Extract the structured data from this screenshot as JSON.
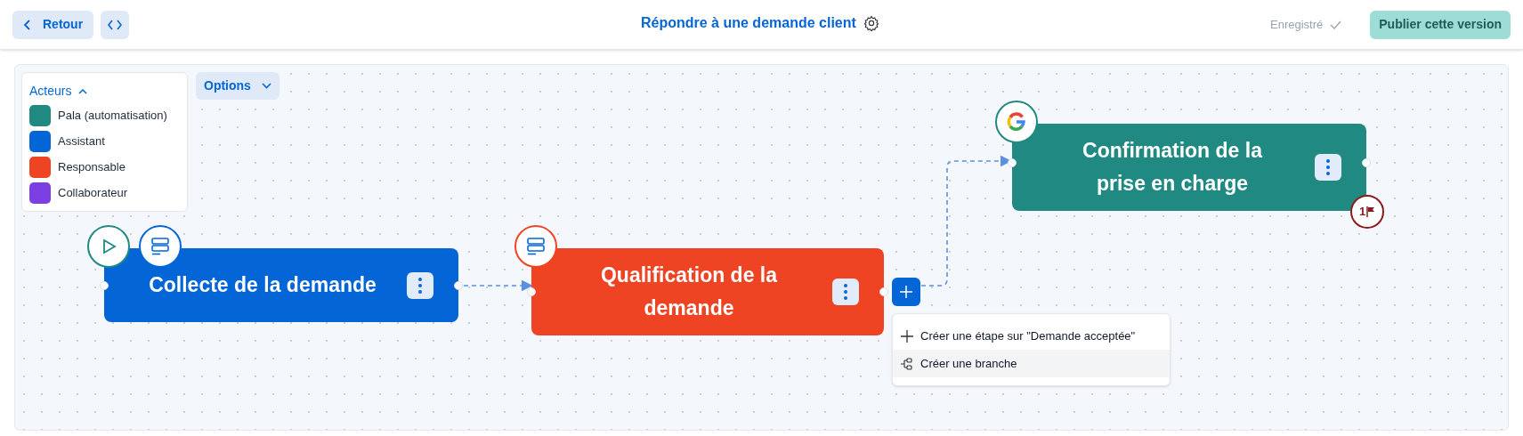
{
  "header": {
    "back_button": "Retour",
    "title": "Répondre à une demande client",
    "save_status": "Enregistré",
    "publish_button": "Publier cette version"
  },
  "legend": {
    "title": "Acteurs",
    "expanded": true,
    "items": [
      {
        "label": "Pala (automatisation)",
        "color": "#208a82"
      },
      {
        "label": "Assistant",
        "color": "#0466d6"
      },
      {
        "label": "Responsable",
        "color": "#ef4423"
      },
      {
        "label": "Collaborateur",
        "color": "#7b3fe4"
      }
    ]
  },
  "options_button": "Options",
  "nodes": [
    {
      "title": "Collecte de la demande",
      "color": "#0466d6",
      "badges": [
        {
          "kind": "start",
          "color": "#208a82"
        },
        {
          "kind": "form",
          "color": "#0466d6"
        }
      ]
    },
    {
      "title": "Qualification de la demande",
      "color": "#ef4423",
      "badges": [
        {
          "kind": "form",
          "color": "#ef4423"
        }
      ]
    },
    {
      "title": "Confirmation de la prise en charge",
      "color": "#208a82",
      "badges": [
        {
          "kind": "logo",
          "color": "#208a82"
        }
      ],
      "flag_count": "1"
    }
  ],
  "add_menu": {
    "items": [
      {
        "kind": "step",
        "label": "Créer une étape sur \"Demande acceptée\"",
        "highlighted": false
      },
      {
        "kind": "branch",
        "label": "Créer une branche",
        "highlighted": true
      }
    ]
  }
}
